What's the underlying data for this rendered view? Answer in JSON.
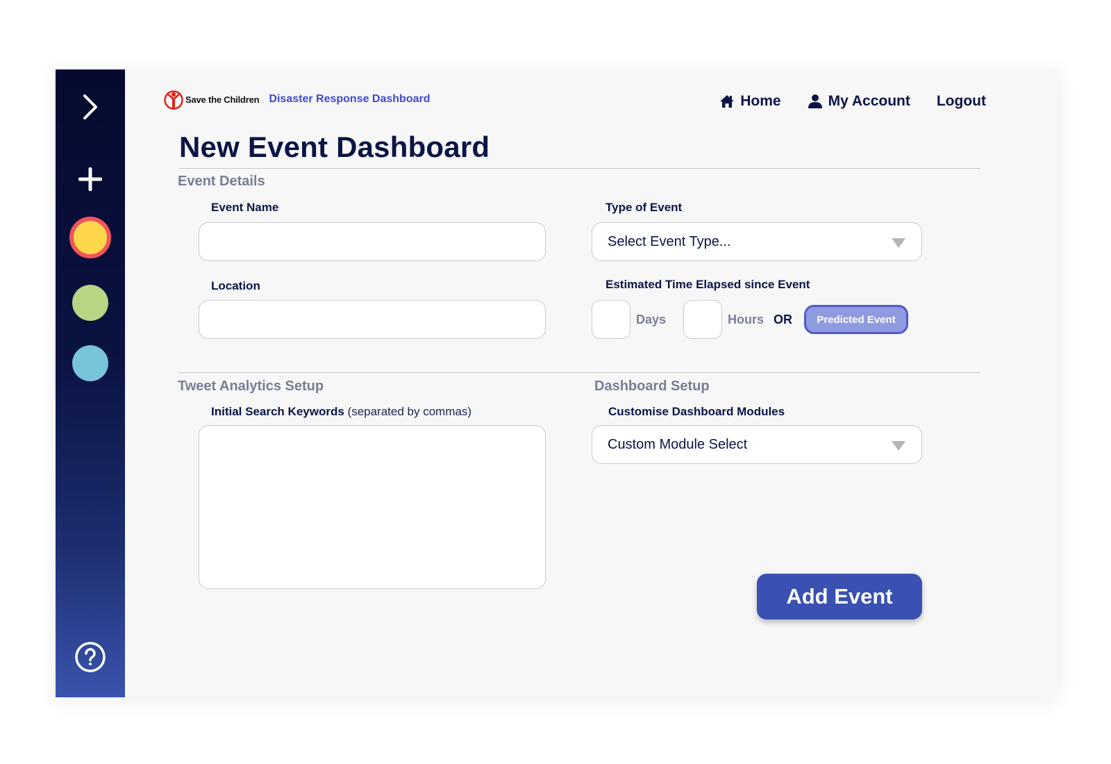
{
  "brand": {
    "org_name": "Save the Children",
    "dashboard_title": "Disaster Response Dashboard",
    "logo_color": "#e1251b"
  },
  "nav": {
    "home": "Home",
    "account": "My Account",
    "logout": "Logout"
  },
  "sidebar": {
    "items": [
      {
        "icon": "chevron-right-icon"
      },
      {
        "icon": "plus-icon"
      },
      {
        "icon": "event-dot",
        "color": "#ffd74a",
        "ring": "#f2545b"
      },
      {
        "icon": "event-dot",
        "color": "#b8d583"
      },
      {
        "icon": "event-dot",
        "color": "#78c4d8"
      },
      {
        "icon": "help-icon"
      }
    ]
  },
  "page": {
    "title": "New Event Dashboard"
  },
  "event_details": {
    "section_title": "Event Details",
    "event_name_label": "Event Name",
    "event_name_value": "",
    "location_label": "Location",
    "location_value": "",
    "type_label": "Type of Event",
    "type_value": "Select Event Type...",
    "elapsed_label": "Estimated Time Elapsed since Event",
    "days_unit": "Days",
    "hours_unit": "Hours",
    "or_label": "OR",
    "predicted_button": "Predicted Event"
  },
  "tweet_setup": {
    "section_title": "Tweet Analytics Setup",
    "keywords_label": "Initial Search Keywords",
    "keywords_hint": "(separated by commas)",
    "keywords_value": ""
  },
  "dashboard_setup": {
    "section_title": "Dashboard Setup",
    "modules_label": "Customise Dashboard Modules",
    "modules_value": "Custom Module Select"
  },
  "actions": {
    "add_event": "Add Event"
  },
  "colors": {
    "navy": "#0b1446",
    "accent": "#3d4bd1",
    "primary_button": "#3a50b2",
    "secondary_button": "#8f9be0"
  }
}
